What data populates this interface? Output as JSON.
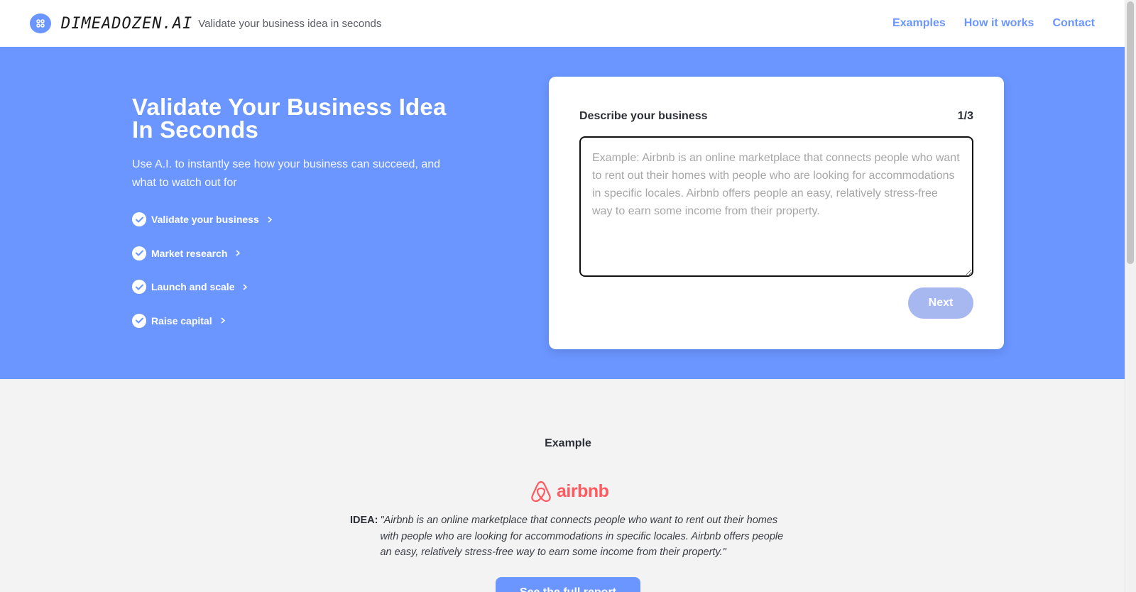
{
  "header": {
    "brand": "DIMEADOZEN.AI",
    "tagline": "Validate your business idea in seconds",
    "nav": [
      "Examples",
      "How it works",
      "Contact"
    ]
  },
  "hero": {
    "title": "Validate Your Business Idea In Seconds",
    "subtitle": "Use A.I. to instantly see how your business can succeed, and what to watch out for",
    "features": [
      "Validate your business",
      "Market research",
      "Launch and scale",
      "Raise capital"
    ]
  },
  "form": {
    "label": "Describe your business",
    "step": "1/3",
    "placeholder": "Example: Airbnb is an online marketplace that connects people who want to rent out their homes with people who are looking for accommodations in specific locales. Airbnb offers people an easy, relatively stress-free way to earn some income from their property.",
    "value": "",
    "next_label": "Next"
  },
  "example": {
    "title": "Example",
    "company": "airbnb",
    "idea_label": "IDEA:",
    "idea_text": "\"Airbnb is an online marketplace that connects people who want to rent out their homes with people who are looking for accommodations in specific locales. Airbnb offers people an easy, relatively stress-free way to earn some income from their property.\"",
    "cta_label": "See the full report"
  },
  "colors": {
    "accent": "#6b96ff",
    "button_disabled": "#a7b8f0",
    "airbnb": "#ff5a5f"
  }
}
